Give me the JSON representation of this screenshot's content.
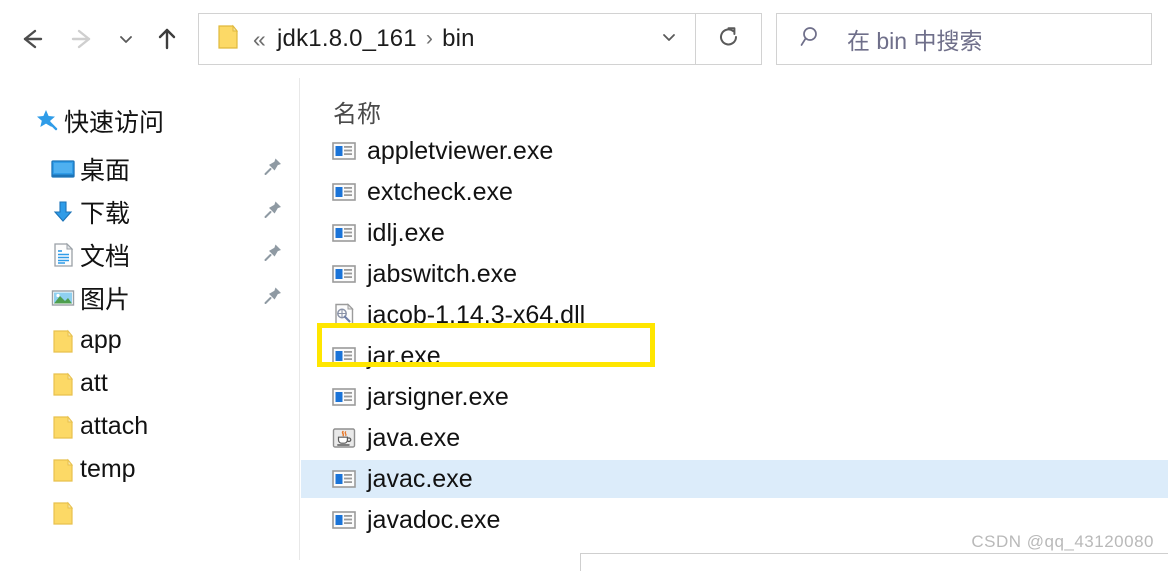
{
  "nav": {
    "back_icon": "arrow-left-icon",
    "forward_icon": "arrow-right-icon",
    "recent_icon": "chevron-down-icon",
    "up_icon": "arrow-up-icon",
    "refresh_icon": "refresh-icon",
    "dropdown_icon": "chevron-down-icon",
    "collapse_icon": "chevron-up-icon"
  },
  "address": {
    "folder_icon": "folder-icon",
    "prefix": "«",
    "crumbs": [
      "jdk1.8.0_161",
      "bin"
    ],
    "separator": "›"
  },
  "search": {
    "icon": "search-icon",
    "placeholder": "在 bin 中搜索"
  },
  "sidebar": {
    "quick_access": {
      "label": "快速访问",
      "icon": "star-pin-icon"
    },
    "items": [
      {
        "label": "桌面",
        "icon": "desktop-icon",
        "pinned": true,
        "type": "special"
      },
      {
        "label": "下载",
        "icon": "download-icon",
        "pinned": true,
        "type": "special"
      },
      {
        "label": "文档",
        "icon": "document-icon",
        "pinned": true,
        "type": "special"
      },
      {
        "label": "图片",
        "icon": "picture-icon",
        "pinned": true,
        "type": "special"
      },
      {
        "label": "app",
        "icon": "folder-icon",
        "pinned": false,
        "type": "folder"
      },
      {
        "label": "att",
        "icon": "folder-icon",
        "pinned": false,
        "type": "folder"
      },
      {
        "label": "attach",
        "icon": "folder-icon",
        "pinned": false,
        "type": "folder"
      },
      {
        "label": "temp",
        "icon": "folder-icon",
        "pinned": false,
        "type": "folder"
      }
    ]
  },
  "file_list": {
    "column_header": "名称",
    "files": [
      {
        "name": "appletviewer.exe",
        "icon": "exe-icon",
        "selected": false,
        "highlighted": false
      },
      {
        "name": "extcheck.exe",
        "icon": "exe-icon",
        "selected": false,
        "highlighted": false
      },
      {
        "name": "idlj.exe",
        "icon": "exe-icon",
        "selected": false,
        "highlighted": false
      },
      {
        "name": "jabswitch.exe",
        "icon": "exe-icon",
        "selected": false,
        "highlighted": false
      },
      {
        "name": "jacob-1.14.3-x64.dll",
        "icon": "dll-icon",
        "selected": false,
        "highlighted": true
      },
      {
        "name": "jar.exe",
        "icon": "exe-icon",
        "selected": false,
        "highlighted": false
      },
      {
        "name": "jarsigner.exe",
        "icon": "exe-icon",
        "selected": false,
        "highlighted": false
      },
      {
        "name": "java.exe",
        "icon": "java-icon",
        "selected": false,
        "highlighted": false
      },
      {
        "name": "javac.exe",
        "icon": "exe-icon",
        "selected": true,
        "highlighted": false
      },
      {
        "name": "javadoc.exe",
        "icon": "exe-icon",
        "selected": false,
        "highlighted": false
      }
    ]
  },
  "colors": {
    "highlight_border": "#ffe600",
    "selection_bg": "#dcecfa",
    "folder_yellow": "#fcd966",
    "accent_blue": "#0a74d0"
  },
  "watermark": "CSDN @qq_43120080"
}
